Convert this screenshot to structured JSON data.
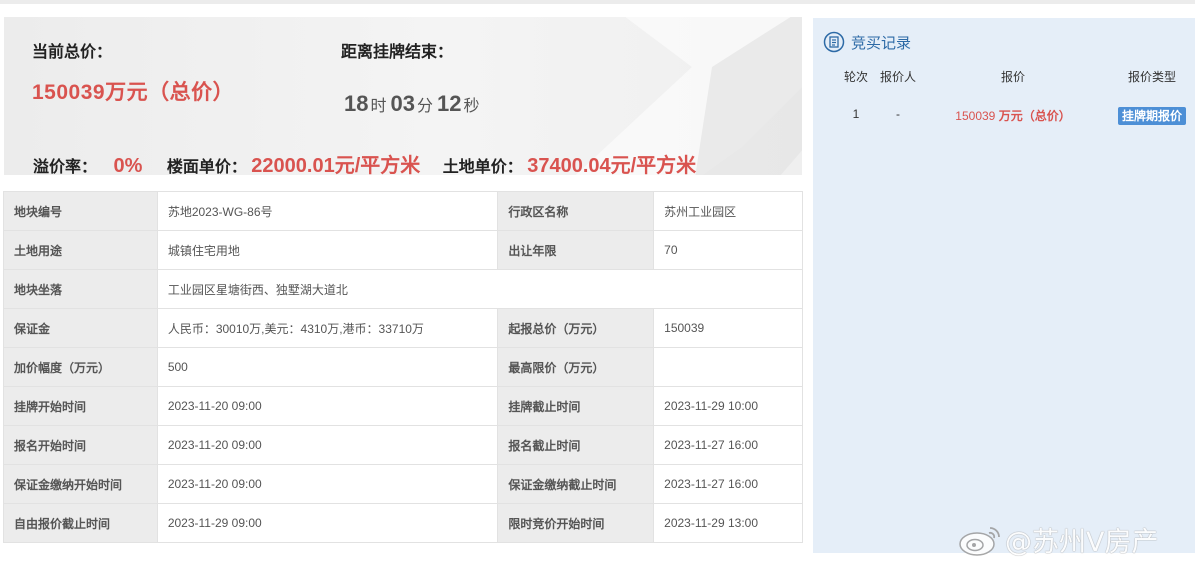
{
  "summary": {
    "current_total_label": "当前总价：",
    "current_total_value": "150039万元（总价）",
    "countdown_label": "距离挂牌结束：",
    "countdown": {
      "hours": "18",
      "hours_unit": "时",
      "minutes": "03",
      "minutes_unit": "分",
      "seconds": "12",
      "seconds_unit": "秒"
    },
    "premium_label": "溢价率：",
    "premium_value": "0%",
    "floor_price_label": "楼面单价：",
    "floor_price_value": "22000.01元/平方米",
    "land_price_label": "土地单价：",
    "land_price_value": "37400.04元/平方米"
  },
  "info": {
    "r1": {
      "k1": "地块编号",
      "v1": "苏地2023-WG-86号",
      "k2": "行政区名称",
      "v2": "苏州工业园区"
    },
    "r2": {
      "k1": "土地用途",
      "v1": "城镇住宅用地",
      "k2": "出让年限",
      "v2": "70"
    },
    "r3": {
      "k1": "地块坐落",
      "v1": "工业园区星塘街西、独墅湖大道北"
    },
    "r4": {
      "k1": "保证金",
      "v1": "人民币：30010万,美元：4310万,港币：33710万",
      "k2": "起报总价（万元）",
      "v2": "150039"
    },
    "r5": {
      "k1": "加价幅度（万元）",
      "v1": "500",
      "k2": "最高限价（万元）",
      "v2": ""
    },
    "r6": {
      "k1": "挂牌开始时间",
      "v1": "2023-11-20 09:00",
      "k2": "挂牌截止时间",
      "v2": "2023-11-29 10:00"
    },
    "r7": {
      "k1": "报名开始时间",
      "v1": "2023-11-20 09:00",
      "k2": "报名截止时间",
      "v2": "2023-11-27 16:00"
    },
    "r8": {
      "k1": "保证金缴纳开始时间",
      "v1": "2023-11-20 09:00",
      "k2": "保证金缴纳截止时间",
      "v2": "2023-11-27 16:00"
    },
    "r9": {
      "k1": "自由报价截止时间",
      "v1": "2023-11-29 09:00",
      "k2": "限时竞价开始时间",
      "v2": "2023-11-29 13:00"
    }
  },
  "records": {
    "title": "竞买记录",
    "headers": {
      "round": "轮次",
      "bidder": "报价人",
      "price": "报价",
      "type": "报价类型"
    },
    "rows": [
      {
        "round": "1",
        "bidder": "-",
        "price_amount": "150039",
        "price_unit": "万元（总价）",
        "type": "挂牌期报价"
      }
    ]
  },
  "watermark": {
    "text": "@苏州V房产"
  },
  "colors": {
    "accent_red": "#d9534f",
    "panel_blue": "#e5eef8",
    "title_blue": "#2d6aa6",
    "tag_blue": "#4d8fd6"
  }
}
